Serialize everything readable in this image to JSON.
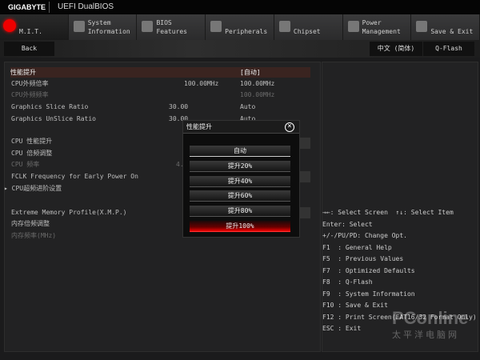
{
  "header": {
    "brand": "GIGABYTE",
    "product": "UEFI DualBIOS"
  },
  "tabs": [
    {
      "label": "M.I.T.",
      "icon": "mit-icon"
    },
    {
      "label": "System\nInformation",
      "icon": "gear-icon"
    },
    {
      "label": "BIOS\nFeatures",
      "icon": "bios-icon"
    },
    {
      "label": "Peripherals",
      "icon": "peripherals-icon"
    },
    {
      "label": "Chipset",
      "icon": "chipset-icon"
    },
    {
      "label": "Power\nManagement",
      "icon": "power-icon"
    },
    {
      "label": "Save & Exit",
      "icon": "exit-icon"
    }
  ],
  "toolbar": {
    "back": "Back",
    "language": "中文 (简体)",
    "qflash": "Q-Flash"
  },
  "settings": [
    {
      "label": "性能提升",
      "current": "",
      "value": "[自动]"
    },
    {
      "label": "CPU外频倍率",
      "current": "100.00MHz",
      "value": "100.00MHz"
    },
    {
      "label": "CPU外频频率",
      "current": "",
      "value": "100.00MHz"
    },
    {
      "label": "Graphics Slice Ratio",
      "current": "30.00",
      "value": "Auto"
    },
    {
      "label": "Graphics UnSlice Ratio",
      "current": "30.00",
      "value": "Auto"
    },
    {
      "label": "CPU 性能提升",
      "current": "",
      "value": ""
    },
    {
      "label": "CPU 倍频调整",
      "current": "",
      "value": ""
    },
    {
      "label": "CPU 频率",
      "current": "4.",
      "value": ""
    },
    {
      "label": "FCLK Frequency for Early Power On",
      "current": "",
      "value": "]"
    },
    {
      "label": "CPU超频进阶设置",
      "current": "",
      "value": ""
    },
    {
      "label": "Extreme Memory Profile(X.M.P.)",
      "current": "",
      "value": ""
    },
    {
      "label": "内存倍频调整",
      "current": "",
      "value": ""
    },
    {
      "label": "内存频率(MHz)",
      "current": "",
      "value": ""
    }
  ],
  "popup": {
    "title": "性能提升",
    "options": [
      "自动",
      "提升20%",
      "提升40%",
      "提升60%",
      "提升80%",
      "提升100%"
    ],
    "selected": "提升100%"
  },
  "help": [
    "→←: Select Screen  ↑↓: Select Item",
    "Enter: Select",
    "+/-/PU/PD: Change Opt.",
    "F1  : General Help",
    "F5  : Previous Values",
    "F7  : Optimized Defaults",
    "F8  : Q-Flash",
    "F9  : System Information",
    "F10 : Save & Exit",
    "F12 : Print Screen(FAT16/32 Format Only)",
    "ESC : Exit"
  ],
  "watermark": {
    "text": "PConline",
    "sub": "太平洋电脑网"
  },
  "colors": {
    "accent": "#e00000",
    "highlight": "#3a2420"
  }
}
